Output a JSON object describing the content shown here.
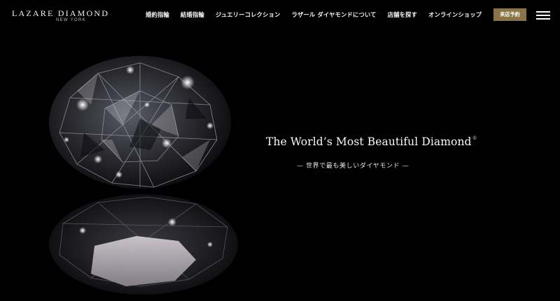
{
  "header": {
    "logo": {
      "name": "LAZARE DIAMOND",
      "sub": "NEW YORK"
    },
    "nav": [
      {
        "id": "engagement",
        "label": "婚約指輪"
      },
      {
        "id": "marriage",
        "label": "結婚指輪"
      },
      {
        "id": "jewelry",
        "label": "ジュエリーコレクション"
      },
      {
        "id": "about",
        "label": "ラザール ダイヤモンドについて"
      },
      {
        "id": "stores",
        "label": "店舗を探す"
      },
      {
        "id": "online",
        "label": "オンラインショップ"
      }
    ],
    "reserve_label": "来店予約",
    "menu_icon": "hamburger-menu-icon"
  },
  "hero": {
    "title": "The World’s Most Beautiful Diamond",
    "title_mark": "®",
    "subtitle": "— 世界で最も美しいダイヤモンド —",
    "image": "diamond-with-reflection"
  },
  "colors": {
    "background": "#000000",
    "reserve_button": "#8a7447",
    "text": "#ffffff"
  }
}
